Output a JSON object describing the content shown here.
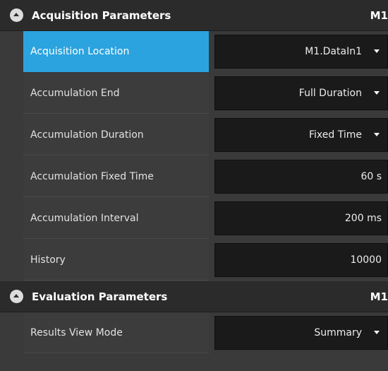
{
  "acquisition": {
    "title": "Acquisition Parameters",
    "right_label": "M1",
    "rows": [
      {
        "label": "Acquisition Location",
        "value": "M1.DataIn1",
        "dropdown": true,
        "selected": true
      },
      {
        "label": "Accumulation End",
        "value": "Full Duration",
        "dropdown": true,
        "selected": false
      },
      {
        "label": "Accumulation Duration",
        "value": "Fixed Time",
        "dropdown": true,
        "selected": false
      },
      {
        "label": "Accumulation Fixed Time",
        "value": "60 s",
        "dropdown": false,
        "selected": false
      },
      {
        "label": "Accumulation Interval",
        "value": "200 ms",
        "dropdown": false,
        "selected": false
      },
      {
        "label": "History",
        "value": "10000",
        "dropdown": false,
        "selected": false
      }
    ]
  },
  "evaluation": {
    "title": "Evaluation Parameters",
    "right_label": "M1",
    "rows": [
      {
        "label": "Results View Mode",
        "value": "Summary",
        "dropdown": true,
        "selected": false
      }
    ]
  },
  "colors": {
    "selected_row": "#2ba3de",
    "header_bg": "#2b2b2b",
    "value_bg": "#1a1a1a"
  }
}
